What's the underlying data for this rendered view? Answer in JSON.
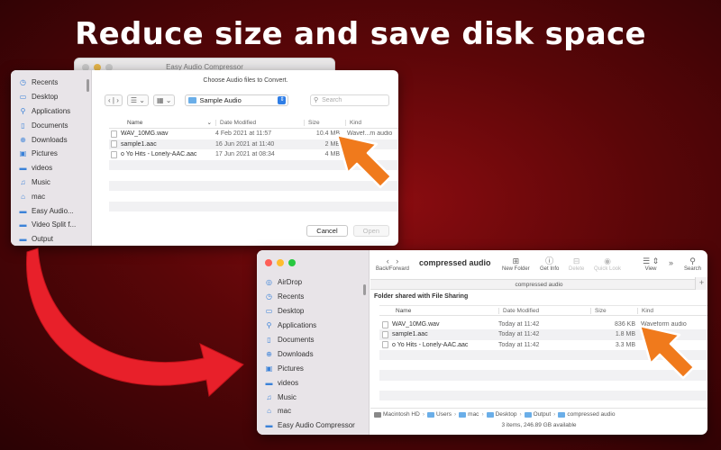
{
  "headline": "Reduce size and save disk space",
  "open_dialog": {
    "app_title": "Easy Audio Compressor",
    "prompt": "Choose Audio files to Convert.",
    "sidebar": [
      {
        "label": "Recents",
        "icon": "clock-icon"
      },
      {
        "label": "Desktop",
        "icon": "desktop-icon"
      },
      {
        "label": "Applications",
        "icon": "applications-icon"
      },
      {
        "label": "Documents",
        "icon": "document-icon"
      },
      {
        "label": "Downloads",
        "icon": "download-icon"
      },
      {
        "label": "Pictures",
        "icon": "pictures-icon"
      },
      {
        "label": "videos",
        "icon": "folder-icon"
      },
      {
        "label": "Music",
        "icon": "music-icon"
      },
      {
        "label": "mac",
        "icon": "home-icon"
      },
      {
        "label": "Easy Audio...",
        "icon": "folder-icon"
      },
      {
        "label": "Video Split f...",
        "icon": "folder-icon"
      },
      {
        "label": "Output",
        "icon": "folder-icon"
      }
    ],
    "location": "Sample Audio",
    "search_placeholder": "Search",
    "columns": {
      "name": "Name",
      "date": "Date Modified",
      "size": "Size",
      "kind": "Kind"
    },
    "files": [
      {
        "name": "WAV_10MG.wav",
        "date": "4 Feb 2021 at 11:57",
        "size": "10.4 MB",
        "kind": "Wavef...m audio"
      },
      {
        "name": "sample1.aac",
        "date": "16 Jun 2021 at 11:40",
        "size": "2 MB",
        "kind": ""
      },
      {
        "name": "o Yo Hits - Lonely-AAC.aac",
        "date": "17 Jun 2021 at 08:34",
        "size": "4 MB",
        "kind": ""
      }
    ],
    "cancel_label": "Cancel",
    "open_label": "Open"
  },
  "finder": {
    "sidebar": [
      {
        "label": "AirDrop",
        "icon": "airdrop-icon"
      },
      {
        "label": "Recents",
        "icon": "clock-icon"
      },
      {
        "label": "Desktop",
        "icon": "desktop-icon"
      },
      {
        "label": "Applications",
        "icon": "applications-icon"
      },
      {
        "label": "Documents",
        "icon": "document-icon"
      },
      {
        "label": "Downloads",
        "icon": "download-icon"
      },
      {
        "label": "Pictures",
        "icon": "pictures-icon"
      },
      {
        "label": "videos",
        "icon": "folder-icon"
      },
      {
        "label": "Music",
        "icon": "music-icon"
      },
      {
        "label": "mac",
        "icon": "home-icon"
      },
      {
        "label": "Easy Audio Compressor",
        "icon": "folder-icon"
      }
    ],
    "title": "compressed audio",
    "toolbar": {
      "back_forward": "Back/Forward",
      "new_folder": "New Folder",
      "get_info": "Get Info",
      "delete": "Delete",
      "quick_look": "Quick Look",
      "view": "View",
      "search": "Search"
    },
    "path_title": "compressed audio",
    "shared_label": "Folder shared with File Sharing",
    "columns": {
      "name": "Name",
      "date": "Date Modified",
      "size": "Size",
      "kind": "Kind"
    },
    "files": [
      {
        "name": "WAV_10MG.wav",
        "date": "Today at 11:42",
        "size": "836 KB",
        "kind": "Waveform audio"
      },
      {
        "name": "sample1.aac",
        "date": "Today at 11:42",
        "size": "1.8 MB",
        "kind": ""
      },
      {
        "name": "o Yo Hits - Lonely-AAC.aac",
        "date": "Today at 11:42",
        "size": "3.3 MB",
        "kind": ""
      }
    ],
    "path": [
      "Macintosh HD",
      "Users",
      "mac",
      "Desktop",
      "Output",
      "compressed audio"
    ],
    "status": "3 items, 246.89 GB available"
  },
  "colors": {
    "arrow_orange": "#f07a1c",
    "arrow_red": "#e8202a",
    "accent_blue": "#2f7ee6"
  }
}
